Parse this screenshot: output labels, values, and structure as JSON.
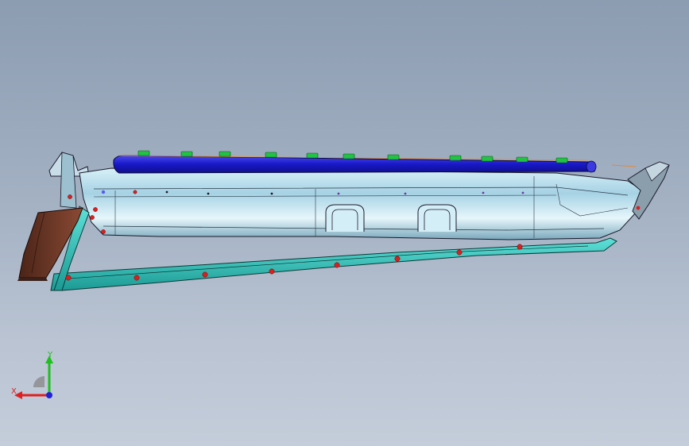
{
  "viewport": {
    "background_top": "#8c9cb1",
    "background_bottom": "#c4cdda",
    "model": "cad-assembly-side-view"
  },
  "triad": {
    "x_label": "X",
    "y_label": "Y",
    "x_color": "#e02020",
    "y_color": "#20c020",
    "z_color": "#2020e0"
  },
  "colors": {
    "body": "#bfe3f0",
    "body_shadow": "#7fb6cc",
    "blue_rail": "#2020d0",
    "green_clips": "#20c040",
    "cyan_sill": "#38c8c0",
    "brown_panel": "#6b3a2a",
    "red_points": "#d82020"
  }
}
